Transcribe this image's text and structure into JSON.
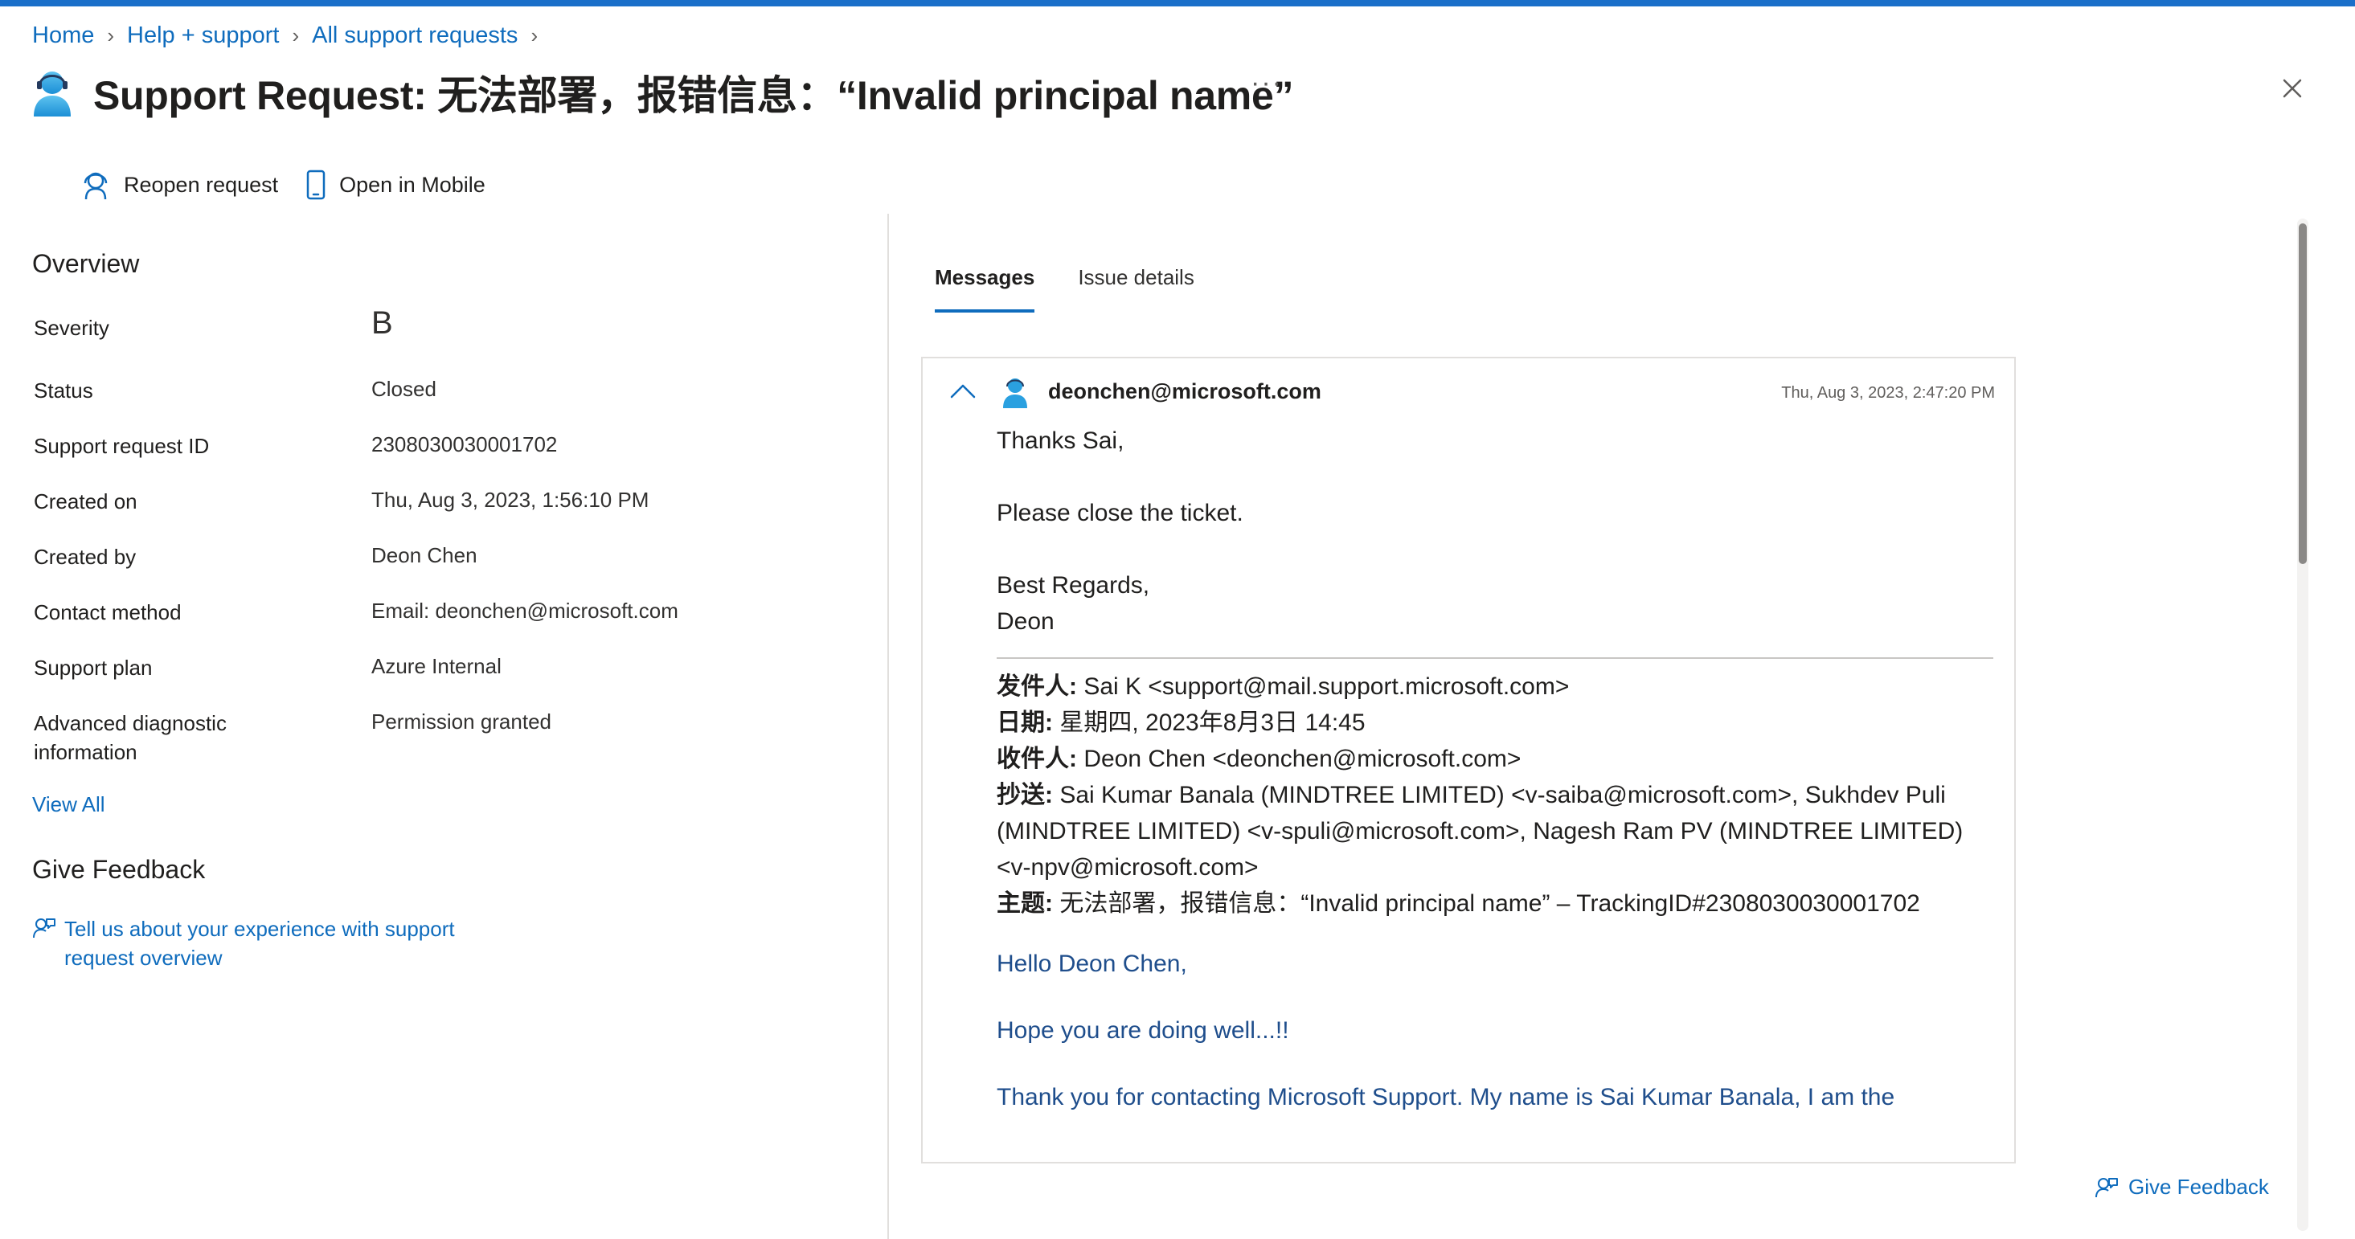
{
  "breadcrumb": {
    "items": [
      "Home",
      "Help + support",
      "All support requests"
    ]
  },
  "header": {
    "title": "Support Request: 无法部署，报错信息：“Invalid principal name”",
    "more_label": "···"
  },
  "commands": {
    "reopen_label": "Reopen request",
    "mobile_label": "Open in Mobile"
  },
  "overview": {
    "title": "Overview",
    "fields": [
      {
        "key": "Severity",
        "value": "B"
      },
      {
        "key": "Status",
        "value": "Closed"
      },
      {
        "key": "Support request ID",
        "value": "2308030030001702"
      },
      {
        "key": "Created on",
        "value": "Thu, Aug 3, 2023, 1:56:10 PM"
      },
      {
        "key": "Created by",
        "value": "Deon Chen"
      },
      {
        "key": "Contact method",
        "value": "Email: deonchen@microsoft.com"
      },
      {
        "key": "Support plan",
        "value": "Azure Internal"
      },
      {
        "key": "Advanced diagnostic information",
        "value": "Permission granted"
      }
    ],
    "view_all": "View All"
  },
  "feedback": {
    "title": "Give Feedback",
    "link_line1": "Tell us about your experience with support",
    "link_line2": "request overview",
    "bottom_label": "Give Feedback"
  },
  "tabs": [
    {
      "label": "Messages",
      "active": true
    },
    {
      "label": "Issue details",
      "active": false
    }
  ],
  "message": {
    "from": "deonchen@microsoft.com",
    "date": "Thu, Aug 3, 2023, 2:47:20 PM",
    "body": {
      "greeting": "Thanks Sai,",
      "line1": "Please close the ticket.",
      "sign1": "Best Regards,",
      "sign2": "Deon"
    },
    "quoted": {
      "from_label": "发件人:",
      "from_value": " Sai K <support@mail.support.microsoft.com>",
      "date_label": "日期:",
      "date_value": " 星期四, 2023年8月3日 14:45",
      "to_label": "收件人:",
      "to_value": " Deon Chen <deonchen@microsoft.com>",
      "cc_label": "抄送:",
      "cc_value": " Sai Kumar Banala (MINDTREE LIMITED) <v-saiba@microsoft.com>, Sukhdev Puli (MINDTREE LIMITED) <v-spuli@microsoft.com>, Nagesh Ram PV (MINDTREE LIMITED) <v-npv@microsoft.com>",
      "subject_label": "主题:",
      "subject_value": " 无法部署，报错信息：“Invalid principal name” – TrackingID#2308030030001702",
      "hello": "Hello Deon Chen,",
      "hope": "Hope you are doing well...!!",
      "thanks": "Thank you for contacting Microsoft Support. My name is Sai Kumar Banala, I am the"
    }
  },
  "colors": {
    "accent": "#0f6cbd",
    "topbar": "#1a6fc9",
    "quoted_text": "#1f4e8c"
  }
}
